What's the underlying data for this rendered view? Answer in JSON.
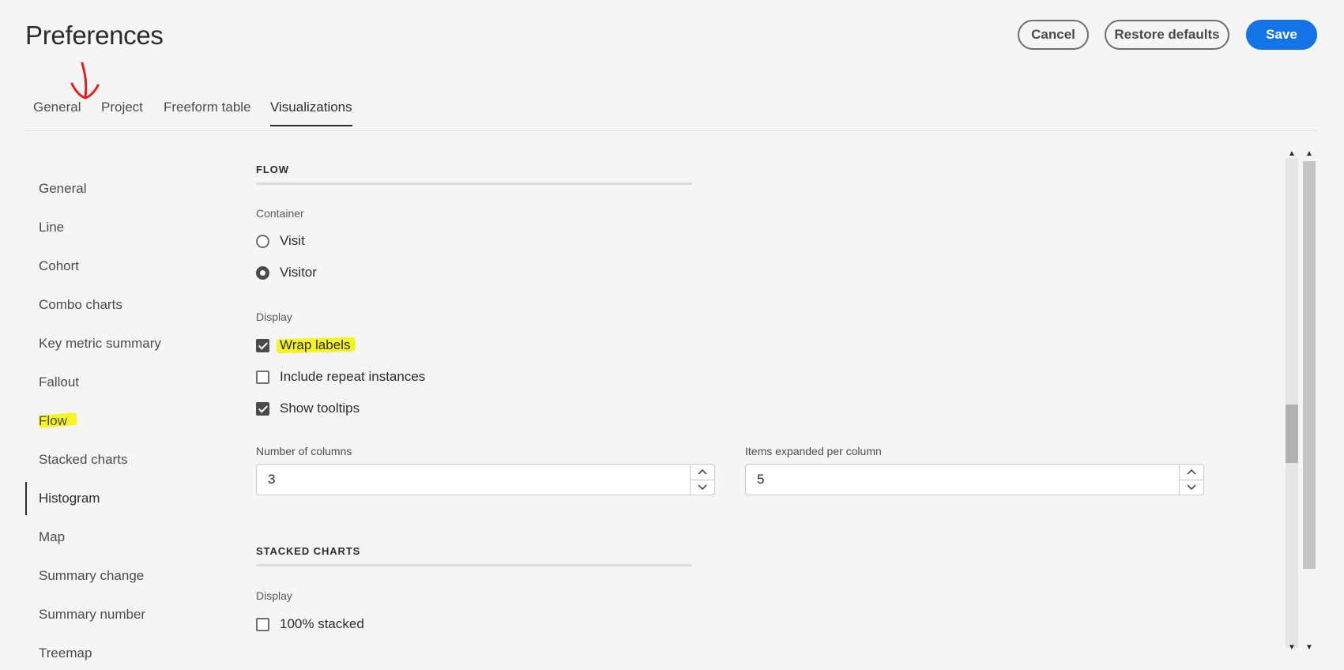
{
  "header": {
    "title": "Preferences",
    "cancel_label": "Cancel",
    "restore_label": "Restore defaults",
    "save_label": "Save"
  },
  "tabs": [
    {
      "label": "General"
    },
    {
      "label": "Project"
    },
    {
      "label": "Freeform table"
    },
    {
      "label": "Visualizations",
      "active": true
    }
  ],
  "sidebar": {
    "items": [
      {
        "label": "General"
      },
      {
        "label": "Line"
      },
      {
        "label": "Cohort"
      },
      {
        "label": "Combo charts"
      },
      {
        "label": "Key metric summary"
      },
      {
        "label": "Fallout"
      },
      {
        "label": "Flow"
      },
      {
        "label": "Stacked charts"
      },
      {
        "label": "Histogram",
        "selected": true
      },
      {
        "label": "Map"
      },
      {
        "label": "Summary change"
      },
      {
        "label": "Summary number"
      },
      {
        "label": "Treemap"
      }
    ]
  },
  "flow": {
    "heading": "FLOW",
    "container_label": "Container",
    "container_options": [
      {
        "label": "Visit",
        "selected": false
      },
      {
        "label": "Visitor",
        "selected": true
      }
    ],
    "display_label": "Display",
    "display_options": [
      {
        "label": "Wrap labels",
        "checked": true
      },
      {
        "label": "Include repeat instances",
        "checked": false
      },
      {
        "label": "Show tooltips",
        "checked": true
      }
    ],
    "columns_label": "Number of columns",
    "columns_value": "3",
    "items_label": "Items expanded per column",
    "items_value": "5"
  },
  "stacked": {
    "heading": "STACKED CHARTS",
    "display_label": "Display",
    "options": [
      {
        "label": "100% stacked",
        "checked": false
      }
    ]
  },
  "colors": {
    "accent": "#1473e6",
    "highlight": "#f5f500",
    "annotation": "#e0201c"
  }
}
